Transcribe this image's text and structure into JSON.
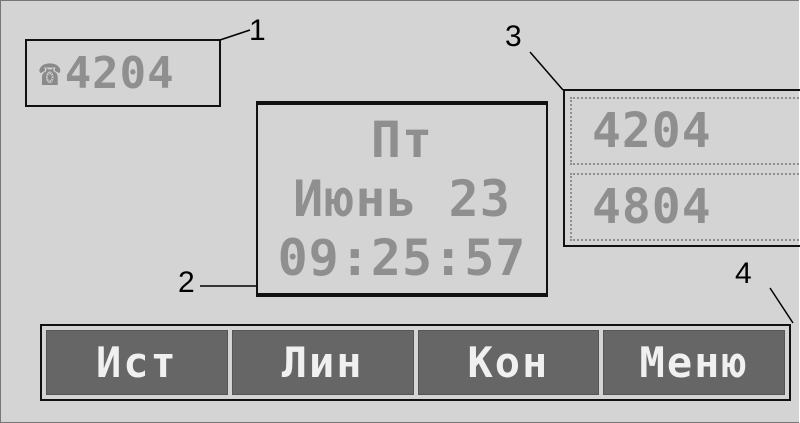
{
  "line_indicator": {
    "icon": "phone-icon",
    "number": "4204"
  },
  "clock": {
    "day": "Пт",
    "date": "Июнь 23",
    "time": "09:25:57"
  },
  "line_keys": [
    "4204",
    "4804"
  ],
  "softkeys": [
    "Ист",
    "Лин",
    "Кон",
    "Меню"
  ],
  "callouts": [
    "1",
    "2",
    "3",
    "4"
  ]
}
